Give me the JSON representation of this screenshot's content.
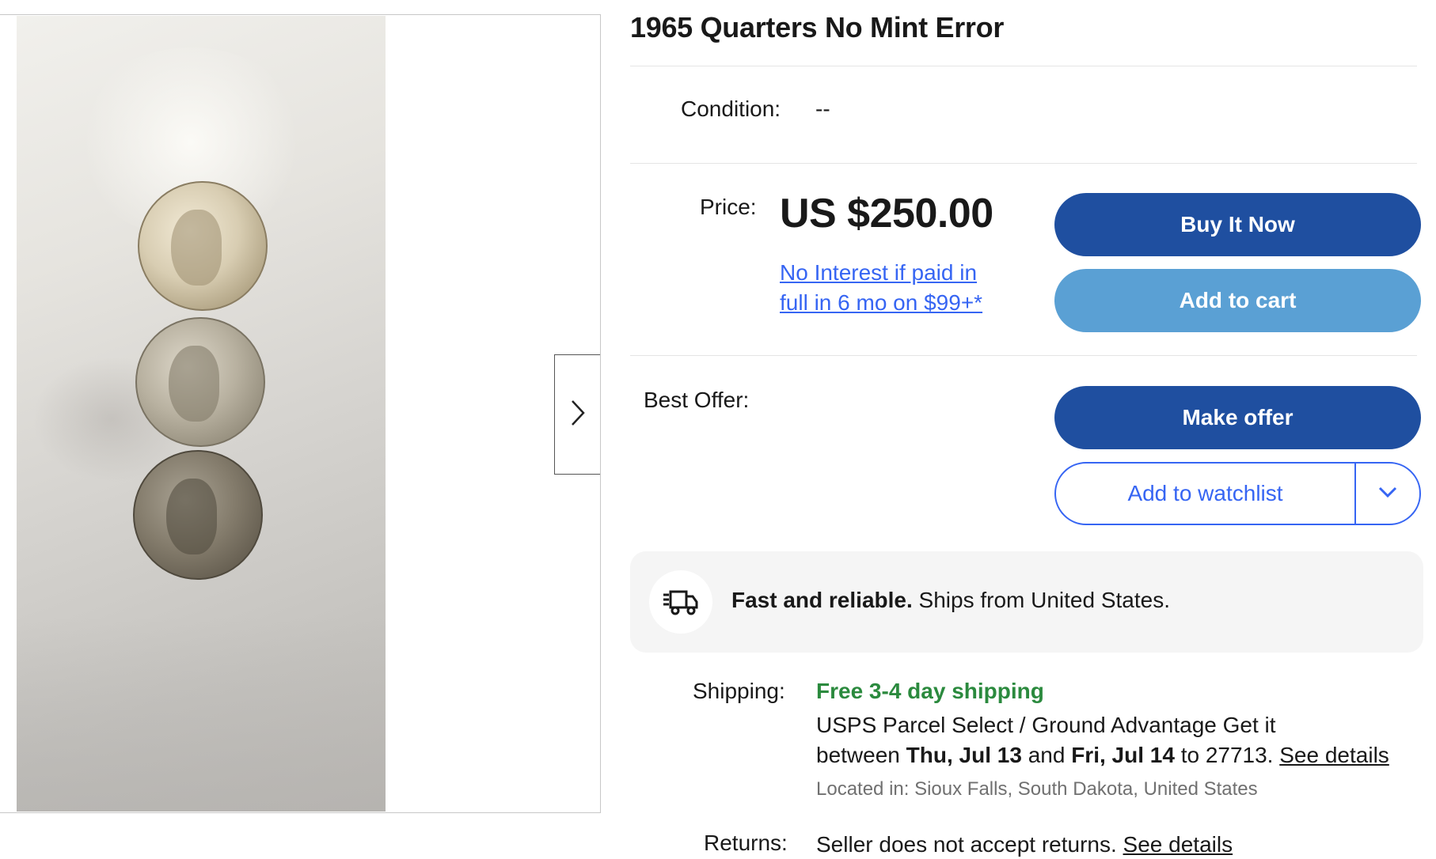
{
  "listing": {
    "title": "1965 Quarters No Mint Error"
  },
  "condition": {
    "label": "Condition:",
    "value": "--"
  },
  "price": {
    "label": "Price:",
    "value": "US $250.00",
    "financing_line1": "No Interest if paid in",
    "financing_line2": "full in 6 mo on $99+*"
  },
  "actions": {
    "buy_now": "Buy It Now",
    "add_to_cart": "Add to cart",
    "best_offer_label": "Best Offer:",
    "make_offer": "Make offer",
    "add_to_watchlist": "Add to watchlist"
  },
  "shipping_banner": {
    "bold": "Fast and reliable.",
    "text": "Ships from United States."
  },
  "shipping": {
    "label": "Shipping:",
    "free": "Free 3-4 day shipping",
    "service": "USPS Parcel Select / Ground Advantage Get it",
    "between": "between",
    "date_from": "Thu, Jul 13",
    "and": "and",
    "date_to": "Fri, Jul 14",
    "to_zip": "to 27713.",
    "see_details": "See details",
    "located": "Located in: Sioux Falls, South Dakota, United States"
  },
  "returns": {
    "label": "Returns:",
    "text": "Seller does not accept returns.",
    "see_details": "See details"
  },
  "icons": {
    "next": "chevron-right-icon",
    "dropdown": "chevron-down-icon",
    "shipping": "fast-truck-icon"
  },
  "colors": {
    "primary_blue": "#1f4fa0",
    "cart_blue": "#5aa0d4",
    "link_blue": "#3665f3",
    "free_green": "#2b8a3e"
  }
}
